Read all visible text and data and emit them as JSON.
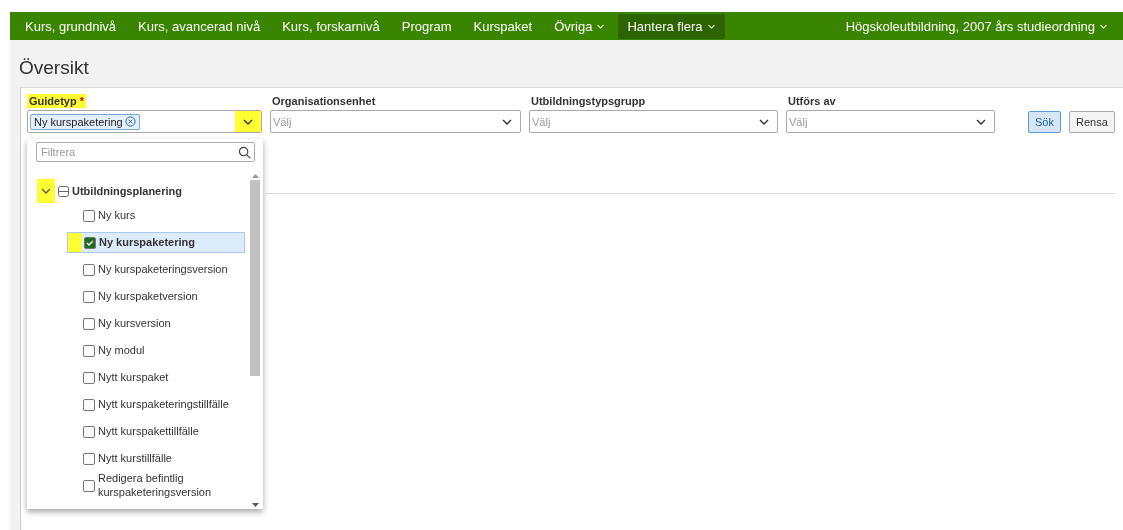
{
  "nav": {
    "items": [
      {
        "label": "Kurs, grundnivå",
        "dropdown": false,
        "selected": false
      },
      {
        "label": "Kurs, avancerad nivå",
        "dropdown": false,
        "selected": false
      },
      {
        "label": "Kurs, forskarnivå",
        "dropdown": false,
        "selected": false
      },
      {
        "label": "Program",
        "dropdown": false,
        "selected": false
      },
      {
        "label": "Kurspaket",
        "dropdown": false,
        "selected": false
      },
      {
        "label": "Övriga",
        "dropdown": true,
        "selected": false
      },
      {
        "label": "Hantera flera",
        "dropdown": true,
        "selected": true
      }
    ],
    "context": {
      "label": "Högskoleutbildning, 2007 års studieordning"
    }
  },
  "page_title": "Översikt",
  "filters": [
    {
      "label": "Guidetyp",
      "required": "*",
      "highlighted": true,
      "chips": [
        "Ny kurspaketering"
      ],
      "toggle_highlighted": true
    },
    {
      "label": "Organisationsenhet",
      "placeholder": "Välj",
      "highlighted": false,
      "toggle_highlighted": false
    },
    {
      "label": "Utbildningstypsgrupp",
      "placeholder": "Välj",
      "highlighted": false,
      "toggle_highlighted": false
    },
    {
      "label": "Utförs av",
      "placeholder": "Välj",
      "highlighted": false,
      "toggle_highlighted": false
    }
  ],
  "buttons": [
    {
      "label": "Sök",
      "primary": true
    },
    {
      "label": "Rensa",
      "primary": false
    }
  ],
  "dropdown": {
    "filter_placeholder": "Filtrera",
    "tree": [
      {
        "label": "Utbildningsplanering",
        "expanded": true,
        "highlighted": true,
        "children": [
          {
            "label": "Ny kurs",
            "checked": false,
            "highlighted": false
          },
          {
            "label": "Ny kurspaketering",
            "checked": true,
            "highlighted": true
          },
          {
            "label": "Ny kurspaketeringsversion",
            "checked": false,
            "highlighted": false
          },
          {
            "label": "Ny kurspaketversion",
            "checked": false,
            "highlighted": false
          },
          {
            "label": "Ny kursversion",
            "checked": false,
            "highlighted": false
          },
          {
            "label": "Ny modul",
            "checked": false,
            "highlighted": false
          },
          {
            "label": "Nytt kurspaket",
            "checked": false,
            "highlighted": false
          },
          {
            "label": "Nytt kurspaketeringstillfälle",
            "checked": false,
            "highlighted": false
          },
          {
            "label": "Nytt kurspakettillfälle",
            "checked": false,
            "highlighted": false
          },
          {
            "label": "Nytt kurstillfälle",
            "checked": false,
            "highlighted": false
          },
          {
            "label": "Redigera befintlig kurspaketeringsversion",
            "checked": false,
            "highlighted": false
          }
        ]
      }
    ]
  }
}
